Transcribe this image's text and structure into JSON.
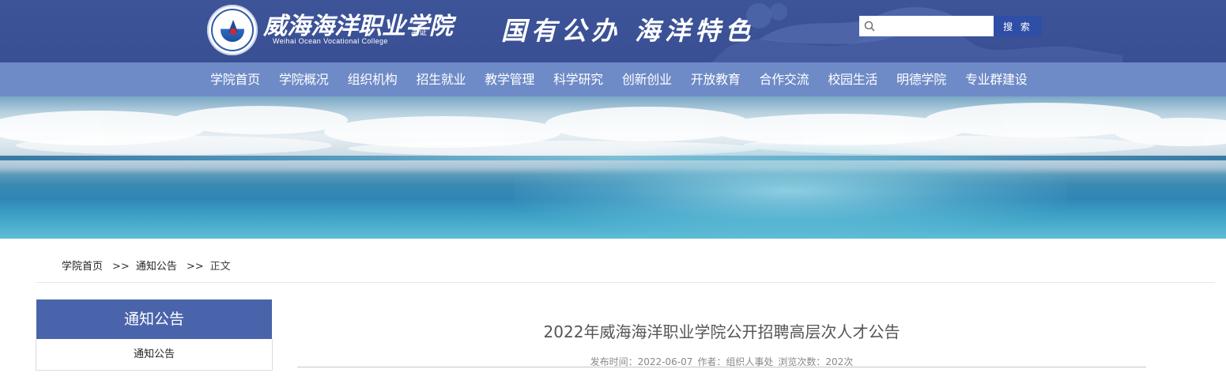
{
  "header": {
    "logo_cn": "威海海洋职业学院",
    "logo_en": "Weihai Ocean Vocational College",
    "logo_sub": "事证",
    "slogan": "国有公办  海洋特色",
    "search_placeholder": "",
    "search_button": "搜 索"
  },
  "nav": {
    "items": [
      "学院首页",
      "学院概况",
      "组织机构",
      "招生就业",
      "教学管理",
      "科学研究",
      "创新创业",
      "开放教育",
      "合作交流",
      "校园生活",
      "明德学院",
      "专业群建设"
    ]
  },
  "breadcrumb": {
    "home": "学院首页",
    "sep1": ">>",
    "section": "通知公告",
    "sep2": ">>",
    "current": "正文"
  },
  "sidebar": {
    "title": "通知公告",
    "items": [
      "通知公告"
    ]
  },
  "article": {
    "title": "2022年威海海洋职业学院公开招聘高层次人才公告",
    "date_label": "发布时间：2022-06-07",
    "author_label": "作者：组织人事处",
    "views_label": "浏览次数：202次"
  },
  "colors": {
    "header_bg": "#3d5499",
    "nav_bg": "#6e8bc7",
    "sidebar_title_bg": "#4a64ab",
    "search_button_bg": "#2f4fa6"
  }
}
